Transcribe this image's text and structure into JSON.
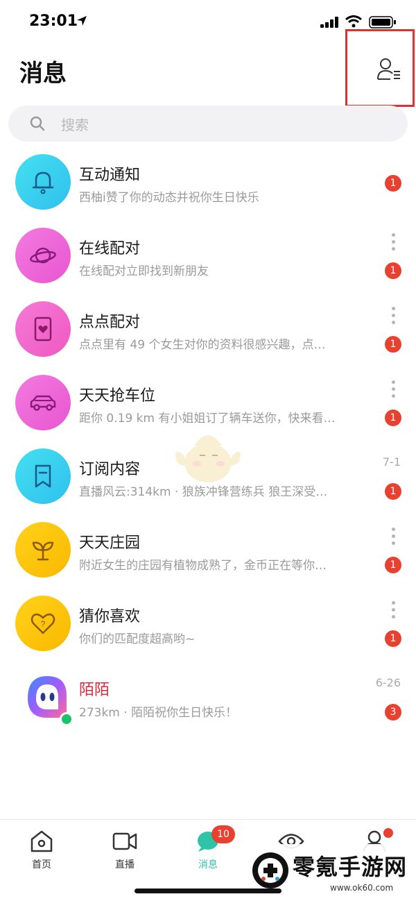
{
  "status": {
    "time": "23:01"
  },
  "header": {
    "title": "消息"
  },
  "search": {
    "placeholder": "搜索"
  },
  "conversations": [
    {
      "title": "互动通知",
      "preview": "西柚i赞了你的动态并祝你生日快乐",
      "badge": "1",
      "time": ""
    },
    {
      "title": "在线配对",
      "preview": "在线配对立即找到新朋友",
      "badge": "1",
      "time": ""
    },
    {
      "title": "点点配对",
      "preview": "点点里有 49 个女生对你的资料很感兴趣，点…",
      "badge": "1",
      "time": ""
    },
    {
      "title": "天天抢车位",
      "preview": "距你 0.19 km 有小姐姐订了辆车送你，快来看…",
      "badge": "1",
      "time": ""
    },
    {
      "title": "订阅内容",
      "preview": "直播风云:314km · 狼族冲锋营练兵 狼王深受…",
      "badge": "1",
      "time": "7-1"
    },
    {
      "title": "天天庄园",
      "preview": "附近女生的庄园有植物成熟了，金币正在等你…",
      "badge": "1",
      "time": ""
    },
    {
      "title": "猜你喜欢",
      "preview": "你们的匹配度超高哟~",
      "badge": "1",
      "time": ""
    },
    {
      "title": "陌陌",
      "preview": "273km · 陌陌祝你生日快乐！",
      "badge": "3",
      "time": "6-26"
    }
  ],
  "colors": {
    "interaction": "#3ad0ee",
    "online_match": "#f064d8",
    "dot_match": "#f564c8",
    "parking": "#f064d8",
    "subscription": "#3ad0ee",
    "garden": "#fdc400",
    "guess_like": "#fdc400",
    "momo_title": "#e0283a",
    "badge": "#e8412f",
    "tab_active": "#2ec4a8"
  },
  "tabs": [
    {
      "label": "首页",
      "icon": "home-icon"
    },
    {
      "label": "直播",
      "icon": "video-icon"
    },
    {
      "label": "消息",
      "icon": "chat-bubble-icon",
      "badge": "10"
    },
    {
      "label": "",
      "icon": "eye-icon"
    },
    {
      "label": "",
      "icon": "profile-icon"
    }
  ],
  "watermark": {
    "name": "零氪手游网",
    "url": "www.ok60.com"
  }
}
